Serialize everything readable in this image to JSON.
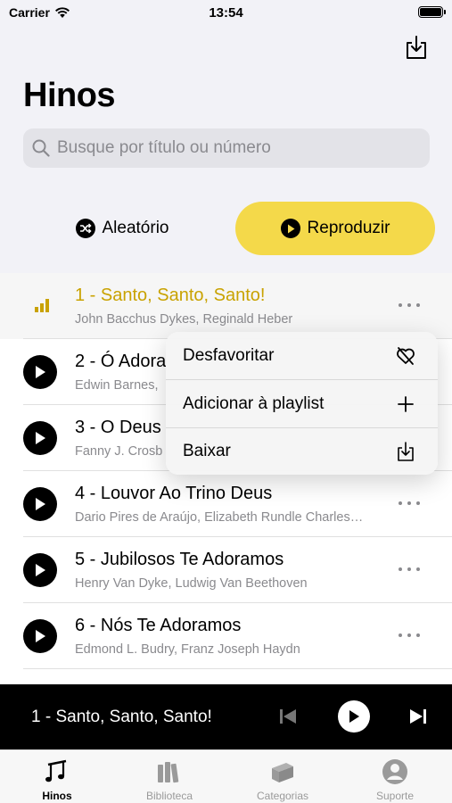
{
  "status_bar": {
    "carrier": "Carrier",
    "time": "13:54"
  },
  "header": {
    "title": "Hinos",
    "download_icon": "download-icon"
  },
  "search": {
    "placeholder": "Busque por título ou número"
  },
  "actions": {
    "shuffle_label": "Aleatório",
    "play_label": "Reproduzir"
  },
  "colors": {
    "accent": "#f4d94a",
    "playing_text": "#c9a200"
  },
  "hymns": [
    {
      "title": "1 - Santo, Santo, Santo!",
      "authors": "John Bacchus Dykes, Reginald Heber",
      "playing": true
    },
    {
      "title": "2 - Ó Adora",
      "authors": "Edwin Barnes,",
      "playing": false
    },
    {
      "title": "3 - O Deus",
      "authors": "Fanny J. Crosb",
      "playing": false
    },
    {
      "title": "4 - Louvor Ao Trino Deus",
      "authors": "Dario Pires de Araújo, Elizabeth Rundle Charles…",
      "playing": false
    },
    {
      "title": "5 - Jubilosos Te Adoramos",
      "authors": "Henry Van Dyke, Ludwig Van Beethoven",
      "playing": false
    },
    {
      "title": "6 - Nós Te Adoramos",
      "authors": "Edmond L. Budry, Franz Joseph Haydn",
      "playing": false
    }
  ],
  "context_menu": [
    {
      "label": "Desfavoritar",
      "icon": "heart-slash-icon"
    },
    {
      "label": "Adicionar à playlist",
      "icon": "plus-icon"
    },
    {
      "label": "Baixar",
      "icon": "download-icon"
    }
  ],
  "mini_player": {
    "now_playing": "1 - Santo, Santo, Santo!"
  },
  "tabs": [
    {
      "label": "Hinos",
      "icon": "music-notes-icon",
      "active": true
    },
    {
      "label": "Biblioteca",
      "icon": "books-icon",
      "active": false
    },
    {
      "label": "Categorias",
      "icon": "stack-icon",
      "active": false
    },
    {
      "label": "Suporte",
      "icon": "person-circle-icon",
      "active": false
    }
  ]
}
